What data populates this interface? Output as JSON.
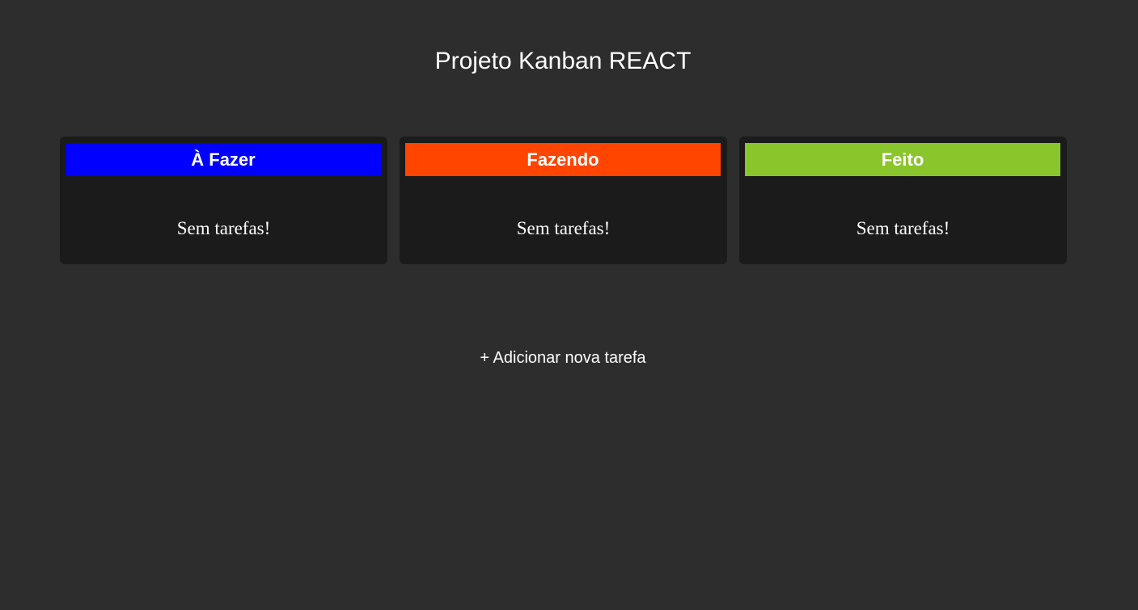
{
  "header": {
    "title": "Projeto Kanban REACT"
  },
  "columns": [
    {
      "title": "À Fazer",
      "empty_message": "Sem tarefas!",
      "color": "#0000ff"
    },
    {
      "title": "Fazendo",
      "empty_message": "Sem tarefas!",
      "color": "#ff4500"
    },
    {
      "title": "Feito",
      "empty_message": "Sem tarefas!",
      "color": "#8ac52c"
    }
  ],
  "actions": {
    "add_task_label": "+ Adicionar nova tarefa"
  },
  "colors": {
    "background": "#2d2d2d",
    "column_background": "#1b1b1b",
    "text": "#ffffff"
  }
}
